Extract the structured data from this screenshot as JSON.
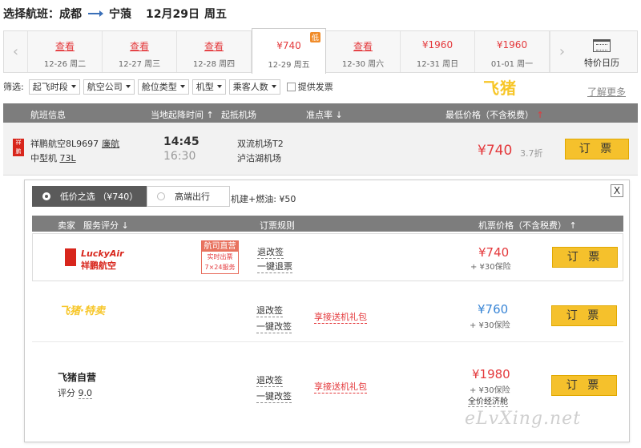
{
  "header": {
    "prefix": "选择航班：",
    "from": "成都",
    "to": "宁蒗",
    "date": "12月29日",
    "weekday": "周五"
  },
  "date_bar": {
    "days": [
      {
        "price": "查看",
        "date": "12-26 周二"
      },
      {
        "price": "查看",
        "date": "12-27 周三"
      },
      {
        "price": "查看",
        "date": "12-28 周四"
      },
      {
        "price": "¥740",
        "date": "12-29 周五",
        "badge": "低"
      },
      {
        "price": "查看",
        "date": "12-30 周六"
      },
      {
        "price": "¥1960",
        "date": "12-31 周日"
      },
      {
        "price": "¥1960",
        "date": "01-01 周一"
      }
    ],
    "calendar_label": "特价日历"
  },
  "filters": {
    "label": "筛选:",
    "items": [
      "起飞时段",
      "航空公司",
      "舱位类型",
      "机型",
      "乘客人数"
    ],
    "invoice_label": "提供发票",
    "logo": "飞猪",
    "more": "了解更多"
  },
  "table_header": {
    "flight": "航班信息",
    "time": "当地起降时间",
    "airport": "起抵机场",
    "ontime": "准点率",
    "price": "最低价格（不含税费）"
  },
  "flight": {
    "airline": "祥鹏航空8L9697",
    "codeshare": "廉航",
    "plane": "中型机",
    "plane_code": "73L",
    "dep_time": "14:45",
    "arr_time": "16:30",
    "dep_airport": "双流机场T2",
    "arr_airport": "泸沽湖机场",
    "price": "¥740",
    "discount": "3.7折",
    "book": "订 票"
  },
  "panel": {
    "tab1": "低价之选 （¥740）",
    "tab2": "高端出行",
    "fuel": "机建+燃油: ¥50",
    "close": "X",
    "header": {
      "seller": "卖家",
      "score": "服务评分",
      "rules": "订票规则",
      "price": "机票价格（不含税费）"
    },
    "sellers": [
      {
        "name_en": "LuckyAir",
        "name_cn": "祥鹏航空",
        "direct_title": "航司直营",
        "direct_line1": "实时出票",
        "direct_line2": "7×24服务",
        "rule1": "退改签",
        "rule2": "一键退票",
        "price": "¥740",
        "insurance": "+ ¥30保险",
        "book": "订 票"
      },
      {
        "name": "飞猪·特卖",
        "rule1": "退改签",
        "rule2": "一键改签",
        "gift": "享接送机礼包",
        "price": "¥760",
        "insurance": "+ ¥30保险",
        "book": "订 票"
      },
      {
        "name": "飞猪自营",
        "score_label": "评分",
        "score": "9.0",
        "rule1": "退改签",
        "rule2": "一键改签",
        "gift": "享接送机礼包",
        "price": "¥1980",
        "insurance": "+ ¥30保险",
        "class": "全价经济舱",
        "book": "订 票"
      }
    ]
  },
  "watermark": "eLvXing.net",
  "colors": {
    "price_red": "#e4393c",
    "book_yellow": "#f5c12c",
    "price_blue": "#3a86d6"
  }
}
